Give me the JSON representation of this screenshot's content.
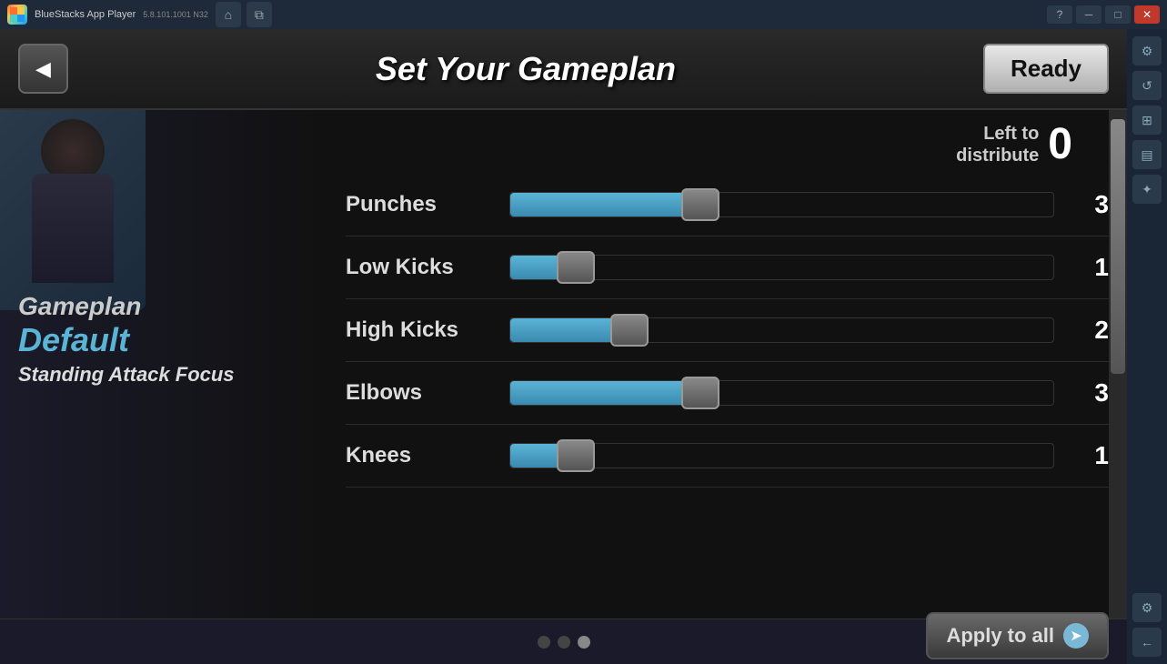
{
  "titlebar": {
    "app_name": "BlueStacks App Player",
    "version": "5.8.101.1001  N32",
    "help_icon": "?",
    "minimize_label": "─",
    "maximize_label": "□",
    "close_label": "✕",
    "home_icon": "⌂",
    "layers_icon": "⧉"
  },
  "header": {
    "back_label": "◀",
    "title": "Set Your Gameplan",
    "ready_label": "Ready"
  },
  "gameplan": {
    "label": "Gameplan",
    "value": "Default",
    "attack_focus": "Standing Attack Focus"
  },
  "distribute": {
    "label": "Left to\ndistribute",
    "value": "0"
  },
  "sliders": [
    {
      "label": "Punches",
      "value": 3,
      "fill_pct": 35,
      "thumb_pct": 35
    },
    {
      "label": "Low Kicks",
      "value": 1,
      "fill_pct": 12,
      "thumb_pct": 12
    },
    {
      "label": "High Kicks",
      "value": 2,
      "fill_pct": 22,
      "thumb_pct": 22
    },
    {
      "label": "Elbows",
      "value": 3,
      "fill_pct": 35,
      "thumb_pct": 35
    },
    {
      "label": "Knees",
      "value": 1,
      "fill_pct": 12,
      "thumb_pct": 12
    }
  ],
  "dots": [
    {
      "active": false
    },
    {
      "active": false
    },
    {
      "active": true
    }
  ],
  "apply_all": {
    "label": "Apply to all",
    "icon": "➤"
  },
  "right_sidebar": {
    "icons": [
      "⚙",
      "↺",
      "⊞",
      "▤",
      "✦",
      "⚙",
      "←"
    ]
  }
}
